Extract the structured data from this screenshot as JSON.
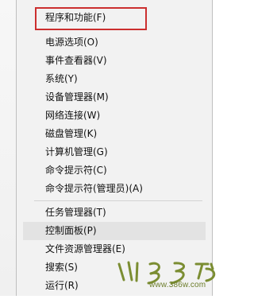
{
  "menu": {
    "items": [
      {
        "label": "程序和功能(F)"
      },
      {
        "label": "电源选项(O)"
      },
      {
        "label": "事件查看器(V)"
      },
      {
        "label": "系统(Y)"
      },
      {
        "label": "设备管理器(M)"
      },
      {
        "label": "网络连接(W)"
      },
      {
        "label": "磁盘管理(K)"
      },
      {
        "label": "计算机管理(G)"
      },
      {
        "label": "命令提示符(C)"
      },
      {
        "label": "命令提示符(管理员)(A)"
      },
      {
        "label": "任务管理器(T)"
      },
      {
        "label": "控制面板(P)"
      },
      {
        "label": "文件资源管理器(E)"
      },
      {
        "label": "搜索(S)"
      },
      {
        "label": "运行(R)"
      }
    ],
    "highlighted_item": "程序和功能(F)",
    "hovered_item": "控制面板(P)"
  },
  "watermark": {
    "text": "www.386w.com"
  },
  "colors": {
    "highlight_box": "#cc2f2f",
    "hover_bg": "#e3e3e3",
    "menu_bg": "#f2f2f2",
    "watermark": "#6c7d2b"
  }
}
